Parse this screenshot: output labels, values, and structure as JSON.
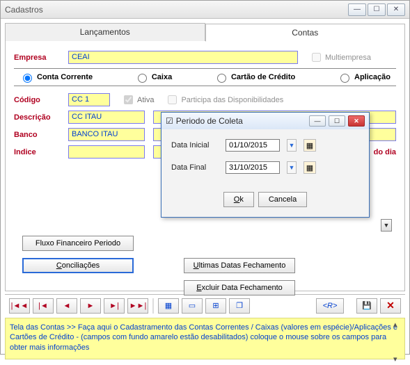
{
  "window": {
    "title": "Cadastros"
  },
  "tabs": {
    "lancamentos": "Lançamentos",
    "contas": "Contas"
  },
  "fields": {
    "empresa_label": "Empresa",
    "empresa_value": "CEAI",
    "multiempresa_label": "Multiempresa",
    "codigo_label": "Código",
    "codigo_value": "CC 1",
    "ativa_label": "Ativa",
    "participa_label": "Participa das Disponibilidades",
    "descricao_label": "Descrição",
    "descricao_value": "CC  ITAU",
    "banco_label": "Banco",
    "banco_value": "BANCO ITAU",
    "indice_label": "Indice",
    "indice_value": "",
    "dodia_label": "do dia"
  },
  "radios": {
    "conta_corrente": "Conta Corrente",
    "caixa": "Caixa",
    "cartao": "Cartão de Crédito",
    "aplicacao": "Aplicação"
  },
  "buttons": {
    "fluxo": "Fluxo Financeiro Periodo",
    "conciliacoes": "Conciliações",
    "ultimas_datas": "Ultimas Datas Fechamento",
    "excluir_data": "Excluir Data Fechamento"
  },
  "nav": {
    "r_label": "<R>"
  },
  "help_text": "Tela das Contas >> Faça aqui o Cadastramento das Contas Correntes / Caixas (valores em espécie)/Aplicações e Cartões de Crédito - (campos com fundo amarelo estão desabilitados)  coloque o mouse sobre os campos para obter mais informações",
  "modal": {
    "title": "Periodo de Coleta",
    "data_inicial_label": "Data Inicial",
    "data_inicial_value": "01/10/2015",
    "data_final_label": "Data Final",
    "data_final_value": "31/10/2015",
    "ok": "Ok",
    "cancela": "Cancela"
  }
}
